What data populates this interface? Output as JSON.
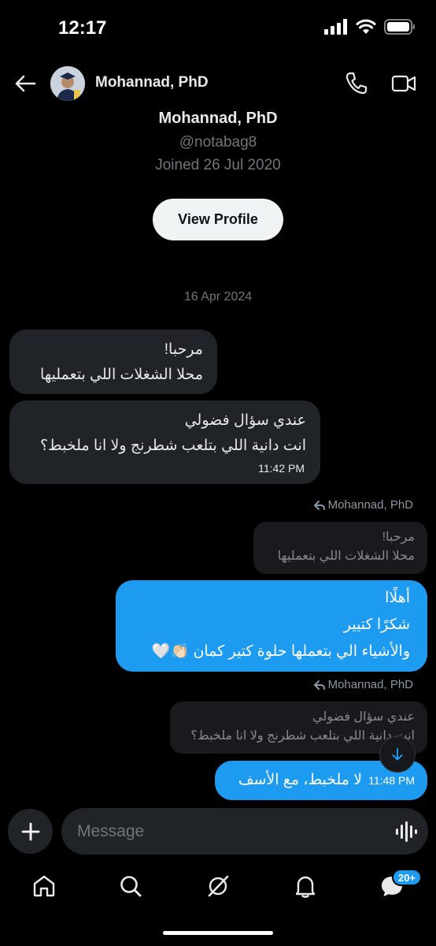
{
  "status_bar": {
    "time": "12:17",
    "icons": [
      "cellular-signal-icon",
      "wifi-icon",
      "battery-icon"
    ]
  },
  "header": {
    "name": "Mohannad, PhD",
    "icons": [
      "back-arrow-icon",
      "phone-call-icon",
      "video-call-icon"
    ]
  },
  "profile": {
    "name": "Mohannad, PhD",
    "handle": "@notabag8",
    "joined": "Joined 26 Jul 2020",
    "view_profile_label": "View Profile"
  },
  "date_separator": "16 Apr 2024",
  "messages": {
    "received_1": {
      "lines": [
        "مرحبا!",
        "محلا الشغلات اللي بتعمليها"
      ]
    },
    "received_2": {
      "lines": [
        "عندي سؤال فضولي",
        "انت دانية اللي بتلعب شطرنج ولا انا ملخبط؟"
      ],
      "time": "11:42 PM"
    },
    "reply_1": {
      "replying_to": "Mohannad, PhD",
      "quote_lines": [
        "مرحبا!",
        "محلا الشغلات اللي بتعمليها"
      ]
    },
    "sent_1": {
      "lines": [
        "أهلًاا",
        "شكرًا كتيير",
        "والأشياء الي بتعملها حلوة كتير كمان 👏🏻🤍"
      ]
    },
    "reply_2": {
      "replying_to": "Mohannad, PhD",
      "quote_lines": [
        "عندي سؤال فضولي",
        "انت دانية اللي بتلعب شطرنج ولا انا ملخبط؟"
      ]
    },
    "sent_2": {
      "text": "لا ملخبط، مع الأسف",
      "time": "11:48 PM"
    }
  },
  "composer": {
    "placeholder": "Message"
  },
  "tab_bar": {
    "items": [
      "home-icon",
      "search-icon",
      "grok-icon",
      "notifications-icon",
      "messages-icon"
    ],
    "messages_badge": "20+"
  },
  "colors": {
    "background": "#000000",
    "accent": "#1d9bf0",
    "bubble_received": "#202327",
    "muted_text": "#71767b"
  }
}
